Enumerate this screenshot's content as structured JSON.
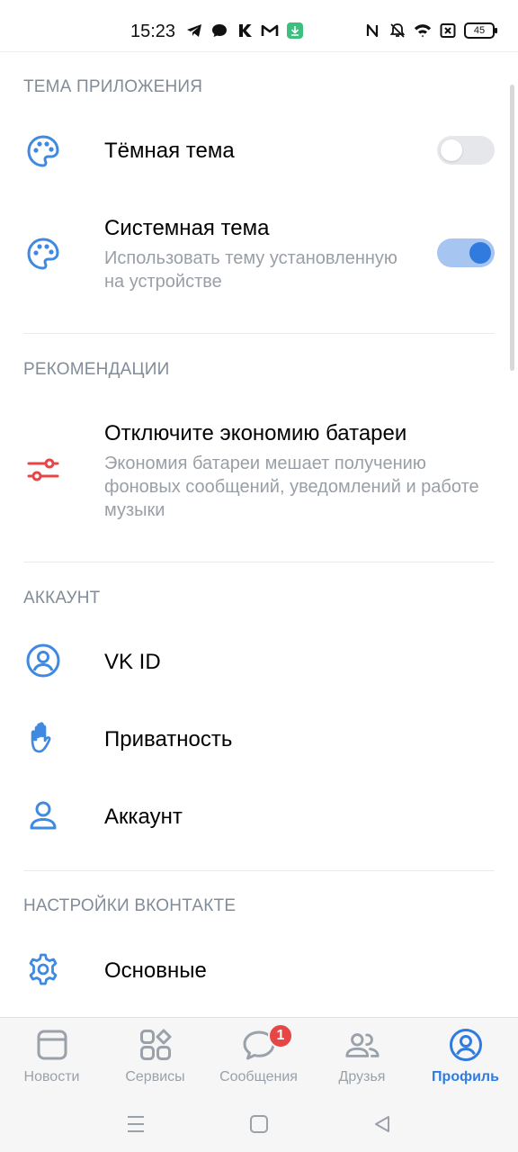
{
  "status_bar": {
    "time": "15:23",
    "battery": "45",
    "left_icons": [
      "telegram-icon",
      "chat-bubble-icon",
      "k-icon",
      "gmail-icon",
      "download-icon"
    ],
    "right_icons": [
      "nfc-icon",
      "bell-off-icon",
      "wifi-icon",
      "sim-off-icon",
      "battery-icon"
    ]
  },
  "sections": {
    "theme": {
      "title": "ТЕМА ПРИЛОЖЕНИЯ",
      "dark": {
        "title": "Тёмная тема",
        "icon": "palette-icon",
        "enabled": false
      },
      "system": {
        "title": "Системная тема",
        "subtitle": "Использовать тему установленную на устройстве",
        "icon": "palette-icon",
        "enabled": true
      }
    },
    "recommendations": {
      "title": "РЕКОМЕНДАЦИИ",
      "battery": {
        "title": "Отключите экономию батареи",
        "subtitle": "Экономия батареи мешает получению фоновых сообщений, уведомлений и работе музыки",
        "icon": "sliders-icon"
      }
    },
    "account": {
      "title": "АККАУНТ",
      "items": [
        {
          "title": "VK ID",
          "icon": "user-circle-icon"
        },
        {
          "title": "Приватность",
          "icon": "hand-icon"
        },
        {
          "title": "Аккаунт",
          "icon": "user-icon"
        }
      ]
    },
    "vk_settings": {
      "title": "НАСТРОЙКИ ВКОНТАКТЕ",
      "items": [
        {
          "title": "Основные",
          "icon": "gear-icon"
        }
      ]
    }
  },
  "tab_bar": {
    "tabs": [
      {
        "label": "Новости",
        "icon": "news-icon"
      },
      {
        "label": "Сервисы",
        "icon": "services-icon"
      },
      {
        "label": "Сообщения",
        "icon": "messages-icon",
        "badge": "1"
      },
      {
        "label": "Друзья",
        "icon": "friends-icon"
      },
      {
        "label": "Профиль",
        "icon": "profile-icon",
        "active": true
      }
    ]
  },
  "colors": {
    "accent": "#2f7bde",
    "icon_blue": "#3f8ae0",
    "warning_red": "#e64646",
    "secondary_text": "#818c99"
  }
}
